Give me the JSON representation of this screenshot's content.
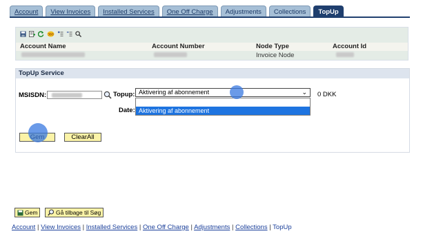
{
  "tabs": [
    {
      "label": "Account",
      "active": false
    },
    {
      "label": "View Invoices",
      "active": false
    },
    {
      "label": "Installed Services",
      "active": false
    },
    {
      "label": "One Off Charge",
      "active": false
    },
    {
      "label": "Adjustments",
      "active": false
    },
    {
      "label": "Collections",
      "active": false
    },
    {
      "label": "TopUp",
      "active": true
    }
  ],
  "account": {
    "headers": {
      "name": "Account Name",
      "number": "Account Number",
      "node_type": "Node Type",
      "account_id": "Account Id"
    },
    "node_type_value": "Invoice Node"
  },
  "topup": {
    "title": "TopUp Service",
    "msisdn_label": "MSISDN:",
    "topup_label": "Topup:",
    "date_label": "Date:",
    "selected": "Aktivering af abonnement",
    "options": [
      "Aktivering af abonnement"
    ],
    "amount": "0 DKK",
    "save_label": "Gem",
    "clear_label": "ClearAll"
  },
  "bottom": {
    "save_label": "Gem",
    "back_label": "Gå tilbage til Søg",
    "links": [
      "Account",
      "View Invoices",
      "Installed Services",
      "One Off Charge",
      "Adjustments",
      "Collections"
    ],
    "current": "TopUp"
  },
  "colors": {
    "tab_active": "#1f3f6e",
    "tab_inactive": "#a6bfd6",
    "button_yellow": "#fbf3a7",
    "dropdown_highlight": "#1e74e0",
    "link": "#1a3f9a"
  }
}
